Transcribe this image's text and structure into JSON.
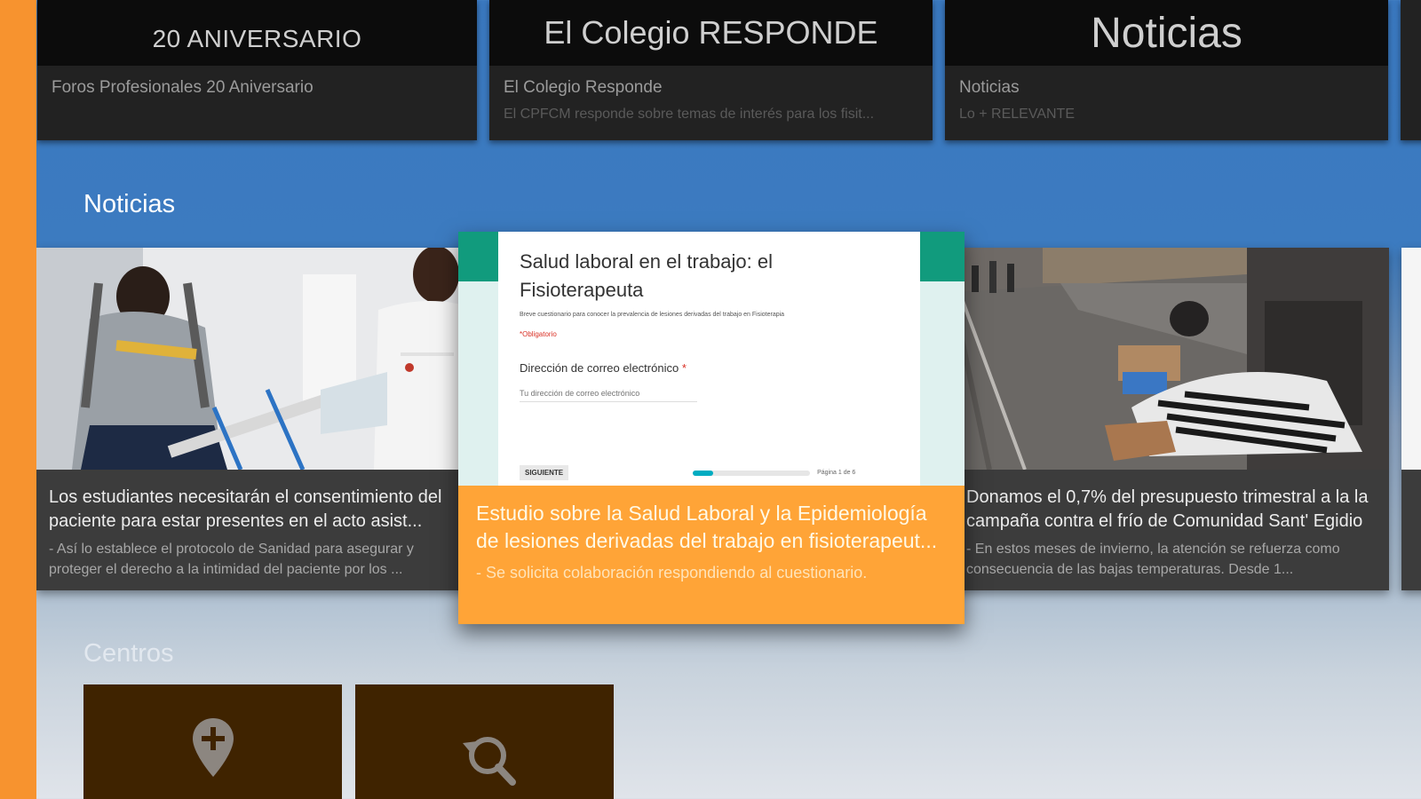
{
  "top_row": [
    {
      "banner": "20 ANIVERSARIO",
      "title": "Foros Profesionales 20 Aniversario",
      "subtitle": ""
    },
    {
      "banner": "El Colegio RESPONDE",
      "title": "El Colegio Responde",
      "subtitle": "El CPFCM responde sobre temas de interés para los fisit..."
    },
    {
      "banner": "Noticias",
      "title": "Noticias",
      "subtitle": "Lo + RELEVANTE"
    }
  ],
  "sections": {
    "noticias": "Noticias",
    "centros": "Centros"
  },
  "news": [
    {
      "title": "Los estudiantes necesitarán el consentimiento del paciente para estar presentes en el acto asist...",
      "description": "- Así lo establece el protocolo de Sanidad para asegurar y proteger el derecho a la intimidad del paciente por los ..."
    },
    {
      "title": "Donamos el 0,7% del presupuesto trimestral a la la campaña contra el frío de Comunidad Sant' Egidio",
      "description": "- En estos meses de invierno, la atención se refuerza como consecuencia de las bajas temperaturas. Desde 1..."
    }
  ],
  "featured": {
    "form": {
      "title": "Salud laboral en el trabajo: el Fisioterapeuta",
      "description": "Breve cuestionario para conocer la prevalencia de lesiones derivadas del trabajo en Fisioterapia",
      "required_note": "*Obligatorio",
      "email_label": "Dirección de correo electrónico",
      "required_star": "*",
      "email_placeholder": "Tu dirección de correo electrónico",
      "next_button": "SIGUIENTE",
      "page_label": "Página 1 de 6",
      "progress": 0.17
    },
    "headline": "Estudio sobre la Salud Laboral y la Epidemiología de lesiones derivadas del trabajo en fisioterapeut...",
    "subtitle": "- Se solicita colaboración respondiendo al cuestionario."
  },
  "centros_tiles": [
    {
      "icon": "add-location-icon"
    },
    {
      "icon": "search-icon"
    }
  ],
  "colors": {
    "sidebar": "#f7932f",
    "featured_bg": "#ffa437",
    "tile_bg": "#3f2300",
    "form_green": "#119b7d"
  }
}
